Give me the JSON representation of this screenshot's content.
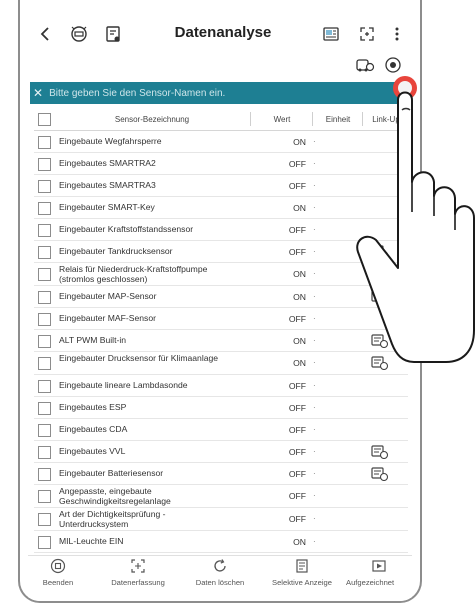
{
  "header": {
    "title": "Datenanalyse"
  },
  "search": {
    "placeholder": "Bitte geben Sie den Sensor-Namen ein."
  },
  "columns": [
    "Sensor-Bezeichnung",
    "Wert",
    "Einheit",
    "Link-Up"
  ],
  "rows": [
    {
      "name": "Eingebaute Wegfahrsperre",
      "value": "ON",
      "link": false
    },
    {
      "name": "Eingebautes SMARTRA2",
      "value": "OFF",
      "link": false
    },
    {
      "name": "Eingebautes SMARTRA3",
      "value": "OFF",
      "link": false
    },
    {
      "name": "Eingebauter SMART-Key",
      "value": "ON",
      "link": false
    },
    {
      "name": "Eingebauter Kraftstoffstandssensor",
      "value": "OFF",
      "link": false
    },
    {
      "name": "Eingebauter Tankdrucksensor",
      "value": "OFF",
      "link": true
    },
    {
      "name": "Relais für Niederdruck-Kraftstoffpumpe (stromlos geschlossen)",
      "value": "ON",
      "link": true
    },
    {
      "name": "Eingebauter MAP-Sensor",
      "value": "ON",
      "link": true
    },
    {
      "name": "Eingebauter MAF-Sensor",
      "value": "OFF",
      "link": false
    },
    {
      "name": "ALT PWM Built-in",
      "value": "ON",
      "link": true
    },
    {
      "name": "Eingebauter Drucksensor für Klimaanlage",
      "value": "ON",
      "link": true
    },
    {
      "name": "Eingebaute lineare Lambdasonde",
      "value": "OFF",
      "link": false
    },
    {
      "name": "Eingebautes ESP",
      "value": "OFF",
      "link": false
    },
    {
      "name": "Eingebautes CDA",
      "value": "OFF",
      "link": false
    },
    {
      "name": "Eingebautes VVL",
      "value": "OFF",
      "link": true
    },
    {
      "name": "Eingebauter Batteriesensor",
      "value": "OFF",
      "link": true
    },
    {
      "name": "Angepasste, eingebaute Geschwindigkeitsregelanlage",
      "value": "OFF",
      "link": false
    },
    {
      "name": "Art der Dichtigkeitsprüfung - Unterdrucksystem",
      "value": "OFF",
      "link": false
    },
    {
      "name": "MIL-Leuchte EIN",
      "value": "ON",
      "link": false
    }
  ],
  "bottom_nav": [
    {
      "label": "Beenden",
      "icon": "stop-circle-icon"
    },
    {
      "label": "Datenerfassung",
      "icon": "capture-icon"
    },
    {
      "label": "Daten löschen",
      "icon": "refresh-icon"
    },
    {
      "label": "Selektive Anzeige",
      "icon": "selective-display-icon"
    },
    {
      "label": "Aufgezeichnet",
      "icon": "recorded-icon"
    }
  ],
  "colors": {
    "search_bar": "#1e7f93",
    "touch_indicator": "#e8453c"
  }
}
